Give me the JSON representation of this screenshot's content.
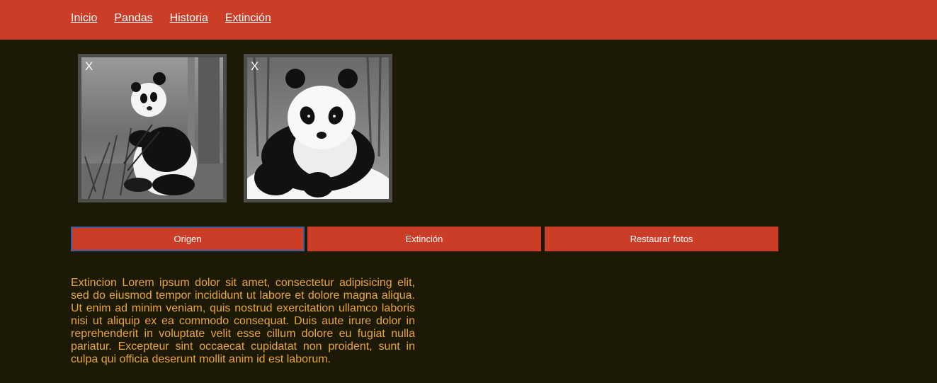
{
  "nav": {
    "items": [
      {
        "label": "Inicio"
      },
      {
        "label": "Pandas"
      },
      {
        "label": "Historia"
      },
      {
        "label": "Extinción"
      }
    ]
  },
  "gallery": {
    "photos": [
      {
        "close_label": "X",
        "subject": "panda sitting eating bamboo"
      },
      {
        "close_label": "X",
        "subject": "panda resting on rock"
      }
    ]
  },
  "buttons": {
    "origen": "Origen",
    "extincion": "Extinción",
    "restaurar": "Restaurar fotos"
  },
  "content": {
    "paragraph": "Extincion Lorem ipsum dolor sit amet, consectetur adipisicing elit, sed do eiusmod tempor incididunt ut labore et dolore magna aliqua. Ut enim ad minim veniam, quis nostrud exercitation ullamco laboris nisi ut aliquip ex ea commodo consequat. Duis aute irure dolor in reprehenderit in voluptate velit esse cillum dolore eu fugiat nulla pariatur. Excepteur sint occaecat cupidatat non proident, sunt in culpa qui officia deserunt mollit anim id est laborum."
  },
  "colors": {
    "header": "#cc3d27",
    "background": "#1c1a07",
    "text": "#e8a53c",
    "button": "#cc3d27"
  }
}
